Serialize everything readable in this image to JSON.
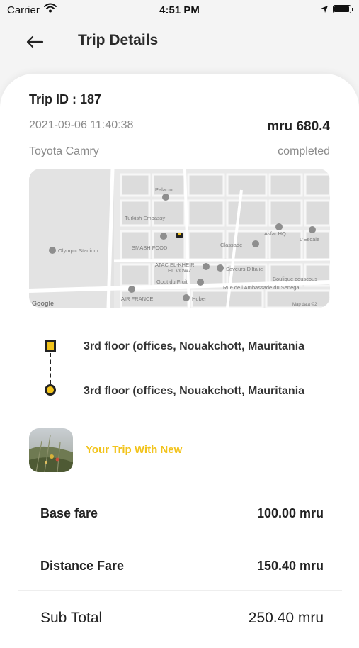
{
  "status_bar": {
    "carrier": "Carrier",
    "time": "4:51 PM"
  },
  "header": {
    "title": "Trip Details"
  },
  "trip": {
    "id_label": "Trip ID : 187",
    "datetime": "2021-09-06 11:40:38",
    "price": "mru 680.4",
    "car": "Toyota Camry",
    "status": "completed"
  },
  "map": {
    "labels": {
      "palacio": "Palacio",
      "turkish_embassy": "Turkish Embassy",
      "smash_food": "SMASH FOOD",
      "olympic_stadium": "Olympic Stadium",
      "asfar_hq": "Asfar HQ",
      "lescale": "L'Escale",
      "classade": "Classade",
      "atac": "ATAC EL-KHEIR",
      "el_vowz": "EL VOWZ",
      "saveurs": "Saveurs D'Italie",
      "gout_du_fruit": "Gout du Fruit",
      "rue": "Rue de l Ambassade du Senegal",
      "boulique": "Boulique couscous",
      "air_france": "AIR FRANCE",
      "huber": "Huber",
      "google": "Google",
      "map_data": "Map data ©2"
    }
  },
  "route": {
    "pickup": "3rd floor (offices, Nouakchott, Mauritania",
    "dropoff": "3rd floor (offices, Nouakchott, Mauritania"
  },
  "driver": {
    "text": "Your Trip With New"
  },
  "fare": {
    "base_label": "Base fare",
    "base_value": "100.00 mru",
    "distance_label": "Distance Fare",
    "distance_value": "150.40 mru",
    "subtotal_label": "Sub Total",
    "subtotal_value": "250.40 mru"
  },
  "colors": {
    "accent": "#f2c31b",
    "text": "#222222",
    "muted": "#8b8b8b"
  }
}
